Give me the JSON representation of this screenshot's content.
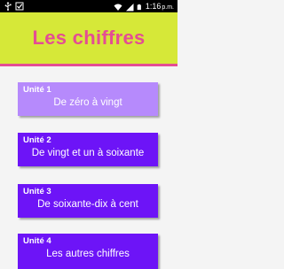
{
  "status_bar": {
    "time": "1:16",
    "ampm": "p.m.",
    "icons": [
      "usb-icon",
      "checkbox-icon",
      "wifi-icon",
      "signal-icon",
      "battery-icon"
    ]
  },
  "header": {
    "title": "Les chiffres",
    "colors": {
      "background": "#d6e838",
      "title": "#e44d93",
      "underline": "#e44d93"
    }
  },
  "units": [
    {
      "number": "Unité 1",
      "label": "De zéro à vingt"
    },
    {
      "number": "Unité 2",
      "label": "De vingt et un à soixante"
    },
    {
      "number": "Unité 3",
      "label": "De soixante-dix à cent"
    },
    {
      "number": "Unité 4",
      "label": "Les autres chiffres"
    }
  ],
  "colors": {
    "card": "#6d14f7",
    "card_selected": "#b68afc"
  }
}
